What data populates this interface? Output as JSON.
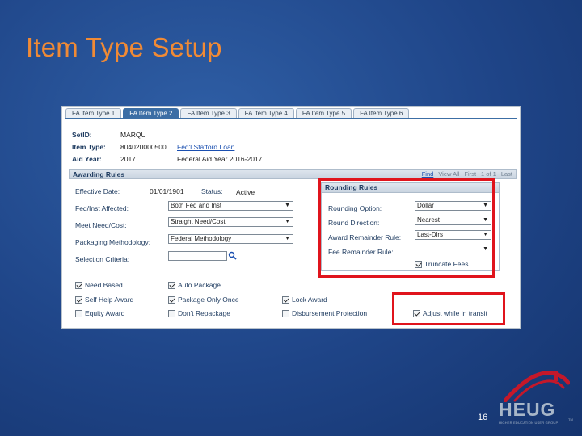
{
  "slide": {
    "title": "Item Type Setup",
    "page_number": "16"
  },
  "tabs": [
    "FA Item Type 1",
    "FA Item Type 2",
    "FA Item Type 3",
    "FA Item Type 4",
    "FA Item Type 5",
    "FA Item Type 6"
  ],
  "active_tab": "FA Item Type 2",
  "info": {
    "setid_label": "SetID:",
    "setid_value": "MARQU",
    "item_type_label": "Item Type:",
    "item_type_value": "804020000500",
    "item_type_link": "Fed'l Stafford Loan",
    "aid_year_label": "Aid Year:",
    "aid_year_value": "2017",
    "aid_year_desc": "Federal Aid Year 2016-2017"
  },
  "awarding_rules": {
    "section_title": "Awarding Rules",
    "nav": {
      "find": "Find",
      "view_all": "View All",
      "first": "First",
      "count": "1 of 1",
      "last": "Last"
    },
    "effective_date_label": "Effective Date:",
    "effective_date_value": "01/01/1901",
    "status_label": "Status:",
    "status_value": "Active",
    "fed_inst_label": "Fed/Inst Affected:",
    "fed_inst_value": "Both Fed and Inst",
    "need_cost_label": "Meet Need/Cost:",
    "need_cost_value": "Straight Need/Cost",
    "packaging_label": "Packaging Methodology:",
    "packaging_value": "Federal Methodology",
    "selection_label": "Selection Criteria:",
    "selection_value": ""
  },
  "rounding_rules": {
    "title": "Rounding Rules",
    "option_label": "Rounding Option:",
    "option_value": "Dollar",
    "direction_label": "Round Direction:",
    "direction_value": "Nearest",
    "award_rem_label": "Award Remainder Rule:",
    "award_rem_value": "Last-Dlrs",
    "fee_rem_label": "Fee Remainder Rule:",
    "fee_rem_value": "",
    "truncate_label": "Truncate Fees",
    "truncate_checked": true
  },
  "checkboxes": {
    "need_based": {
      "label": "Need Based",
      "checked": true
    },
    "auto_package": {
      "label": "Auto Package",
      "checked": true
    },
    "self_help": {
      "label": "Self Help Award",
      "checked": true
    },
    "package_once": {
      "label": "Package Only Once",
      "checked": true
    },
    "lock_award": {
      "label": "Lock Award",
      "checked": true
    },
    "equity_award": {
      "label": "Equity Award",
      "checked": false
    },
    "dont_repackage": {
      "label": "Don't Repackage",
      "checked": false
    },
    "disbursement_protection": {
      "label": "Disbursement Protection",
      "checked": false
    },
    "adjust_in_transit": {
      "label": "Adjust while in transit",
      "checked": true
    }
  },
  "logo": {
    "letters": "HEUG",
    "tagline": "HIGHER EDUCATION USER GROUP",
    "tm": "TM"
  },
  "colors": {
    "title": "#f08a35",
    "highlight": "#e0141c",
    "tab_active": "#3c6ea5",
    "background": "#1f4588"
  }
}
